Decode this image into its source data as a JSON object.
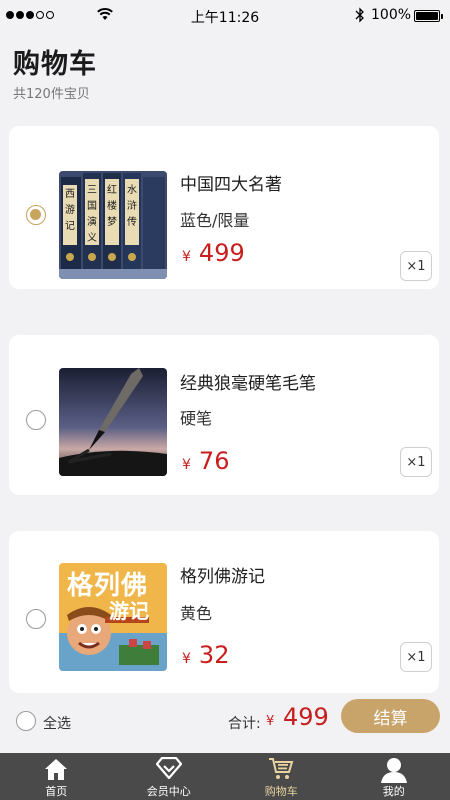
{
  "status_bar": {
    "time": "上午11:26",
    "battery": "100%",
    "signal_icon": "signal-dots-icon",
    "wifi_icon": "wifi-icon",
    "bluetooth_icon": "bluetooth-icon"
  },
  "header": {
    "title": "购物车",
    "count_text": "共120件宝贝"
  },
  "cart": {
    "items": [
      {
        "name": "中国四大名著",
        "variant": "蓝色/限量",
        "currency": "¥",
        "price": "499",
        "qty": "×1",
        "selected": true,
        "thumb": "books-image"
      },
      {
        "name": "经典狼毫硬笔毛笔",
        "variant": "硬笔",
        "currency": "¥",
        "price": "76",
        "qty": "×1",
        "selected": false,
        "thumb": "pen-image"
      },
      {
        "name": "格列佛游记",
        "variant": "黄色",
        "currency": "¥",
        "price": "32",
        "qty": "×1",
        "selected": false,
        "thumb": "gulliver-book-cover",
        "cover_title": "格列佛",
        "cover_subtitle": "游记"
      }
    ]
  },
  "summary": {
    "select_all": "全选",
    "total_label": "合计:",
    "total_currency": "¥",
    "total_value": "499",
    "checkout": "结算"
  },
  "tabbar": {
    "tabs": [
      {
        "label": "首页",
        "icon": "home-icon"
      },
      {
        "label": "会员中心",
        "icon": "diamond-icon"
      },
      {
        "label": "购物车",
        "icon": "cart-icon"
      },
      {
        "label": "我的",
        "icon": "person-icon"
      }
    ],
    "active_index": 2
  },
  "colors": {
    "accent": "#c8a46a",
    "price": "#c81e1e",
    "tabbar_bg": "#4a4a4a",
    "background": "#f2f1f4"
  }
}
